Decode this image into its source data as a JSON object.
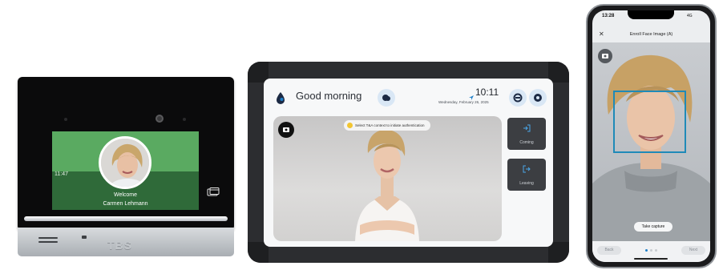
{
  "terminal": {
    "time": "11:47",
    "welcome": "Welcome",
    "user_name": "Carmen Lehmann",
    "brand": "TBS",
    "colors": {
      "screen_top": "#5aaa61",
      "screen_bottom": "#2f6a39"
    }
  },
  "tablet": {
    "greeting": "Good morning",
    "time": "10:11",
    "date": "Wednesday, February 26, 2025",
    "prompt": "Select T&A context to initiate authentication",
    "actions": [
      {
        "label": "Coming",
        "icon": "login-arrow-icon"
      },
      {
        "label": "Leaving",
        "icon": "logout-arrow-icon"
      }
    ],
    "colors": {
      "accent": "#1e7fc9",
      "button_bg": "#3c3e42"
    }
  },
  "phone": {
    "status_time": "13:28",
    "status_right": "4G",
    "title": "Enroll Face Image (A)",
    "capture_label": "Take capture",
    "back_label": "Back",
    "next_label": "Next",
    "colors": {
      "frame": "#1f8ab8"
    }
  }
}
